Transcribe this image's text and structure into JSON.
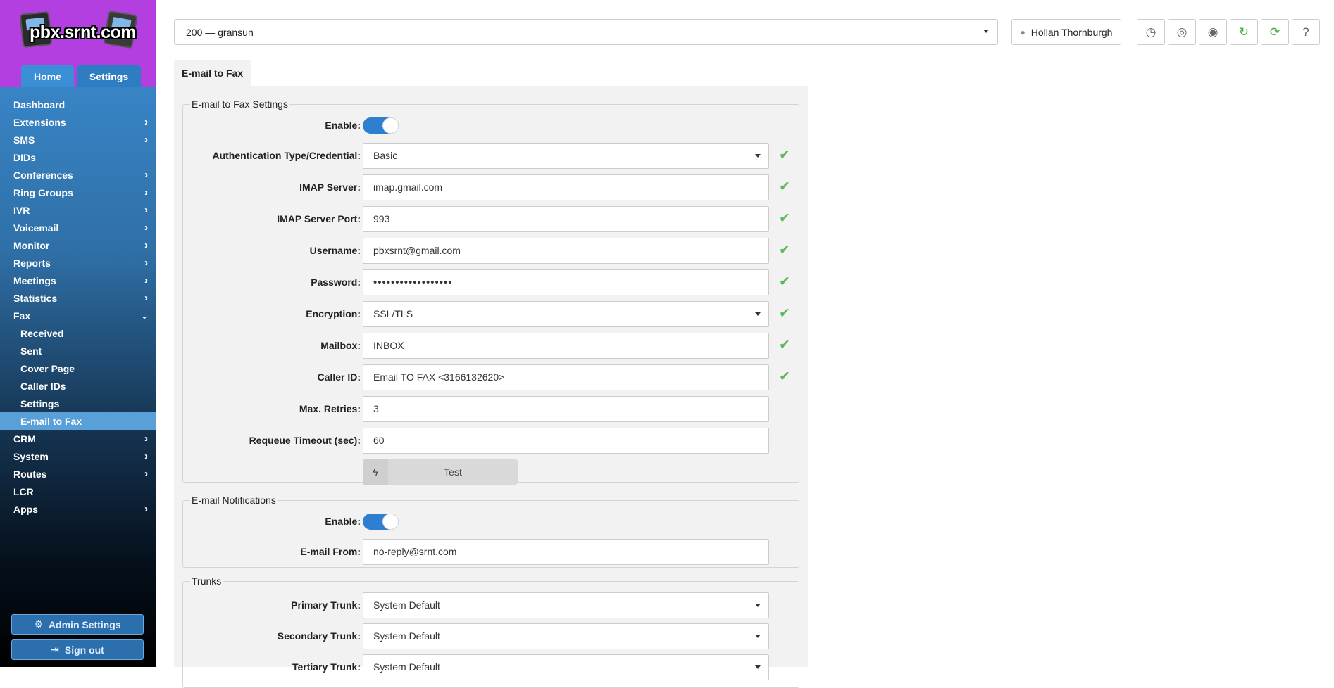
{
  "brand": {
    "logo_text": "pbx.srnt.com"
  },
  "top_tabs": [
    {
      "label": "Home",
      "active": false
    },
    {
      "label": "Settings",
      "active": true
    }
  ],
  "nav": [
    {
      "label": "Dashboard",
      "has_submenu": false
    },
    {
      "label": "Extensions",
      "has_submenu": true
    },
    {
      "label": "SMS",
      "has_submenu": true
    },
    {
      "label": "DIDs",
      "has_submenu": false
    },
    {
      "label": "Conferences",
      "has_submenu": true
    },
    {
      "label": "Ring Groups",
      "has_submenu": true
    },
    {
      "label": "IVR",
      "has_submenu": true
    },
    {
      "label": "Voicemail",
      "has_submenu": true
    },
    {
      "label": "Monitor",
      "has_submenu": true
    },
    {
      "label": "Reports",
      "has_submenu": true
    },
    {
      "label": "Meetings",
      "has_submenu": true
    },
    {
      "label": "Statistics",
      "has_submenu": true
    },
    {
      "label": "Fax",
      "has_submenu": true,
      "expanded": true,
      "children": [
        {
          "label": "Received"
        },
        {
          "label": "Sent"
        },
        {
          "label": "Cover Page"
        },
        {
          "label": "Caller IDs"
        },
        {
          "label": "Settings"
        },
        {
          "label": "E-mail to Fax",
          "active": true
        }
      ]
    },
    {
      "label": "CRM",
      "has_submenu": true
    },
    {
      "label": "System",
      "has_submenu": true
    },
    {
      "label": "Routes",
      "has_submenu": true
    },
    {
      "label": "LCR",
      "has_submenu": false
    },
    {
      "label": "Apps",
      "has_submenu": true
    }
  ],
  "sidebar_buttons": {
    "admin_settings": "Admin Settings",
    "sign_out": "Sign out"
  },
  "header": {
    "extension_select": "200  —  gransun",
    "user_name": "Hollan Thornburgh",
    "tools": [
      "clock-icon",
      "lifebuoy-icon",
      "globe-icon",
      "refresh-icon",
      "sync-icon",
      "help-icon"
    ]
  },
  "tab": {
    "label": "E-mail to Fax"
  },
  "email_to_fax": {
    "legend": "E-mail to Fax Settings",
    "enable_label": "Enable:",
    "enabled": true,
    "fields": [
      {
        "label": "Authentication Type/Credential:",
        "value": "Basic",
        "type": "select",
        "valid": true
      },
      {
        "label": "IMAP Server:",
        "value": "imap.gmail.com",
        "type": "text",
        "valid": true
      },
      {
        "label": "IMAP Server Port:",
        "value": "993",
        "type": "text",
        "valid": true
      },
      {
        "label": "Username:",
        "value": "pbxsrnt@gmail.com",
        "type": "text",
        "valid": true
      },
      {
        "label": "Password:",
        "value": "••••••••••••••••••",
        "type": "password",
        "valid": true
      },
      {
        "label": "Encryption:",
        "value": "SSL/TLS",
        "type": "select",
        "valid": true
      },
      {
        "label": "Mailbox:",
        "value": "INBOX",
        "type": "text",
        "valid": true
      },
      {
        "label": "Caller ID:",
        "value": "Email TO FAX <3166132620>",
        "type": "text",
        "valid": true
      },
      {
        "label": "Max. Retries:",
        "value": "3",
        "type": "text",
        "valid": false
      },
      {
        "label": "Requeue Timeout (sec):",
        "value": "60",
        "type": "text",
        "valid": false
      }
    ],
    "test_button": "Test"
  },
  "notifications": {
    "legend": "E-mail Notifications",
    "enable_label": "Enable:",
    "enabled": true,
    "from_label": "E-mail From:",
    "from_value": "no-reply@srnt.com"
  },
  "trunks": {
    "legend": "Trunks",
    "fields": [
      {
        "label": "Primary Trunk:",
        "value": "System Default"
      },
      {
        "label": "Secondary Trunk:",
        "value": "System Default"
      },
      {
        "label": "Tertiary Trunk:",
        "value": "System Default"
      }
    ]
  },
  "colors": {
    "sidebar_top": "#3c8fd6",
    "logo_bg": "#b43fe0",
    "accent": "#2f7fd1",
    "valid": "#5cb85c"
  }
}
